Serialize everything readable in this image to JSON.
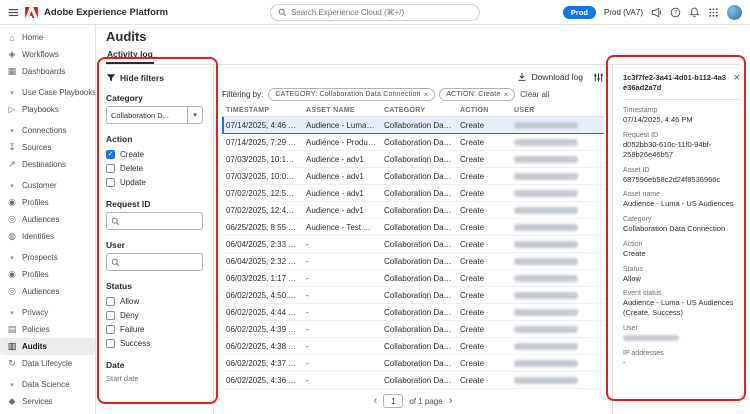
{
  "colors": {
    "accent_blue": "#1473E6",
    "adobe_red": "#EB1000",
    "annotation_red": "#E02020",
    "selected_row_bg": "#E4EFFB"
  },
  "header": {
    "app_title": "Adobe Experience Platform",
    "search_placeholder": "Search Experience Cloud (⌘+/)",
    "env_button": "Prod",
    "env_label": "Prod (VA7)"
  },
  "sidebar": {
    "items": [
      {
        "type": "item",
        "label": "Home",
        "icon": "home-icon",
        "glyph": "⌂"
      },
      {
        "type": "item",
        "label": "Workflows",
        "icon": "workflows-icon",
        "glyph": "◈"
      },
      {
        "type": "item",
        "label": "Dashboards",
        "icon": "dashboards-icon",
        "glyph": "▦"
      },
      {
        "type": "section",
        "label": "Use Case Playbooks"
      },
      {
        "type": "item",
        "label": "Playbooks",
        "icon": "playbooks-icon",
        "glyph": "▷"
      },
      {
        "type": "section",
        "label": "Connections"
      },
      {
        "type": "item",
        "label": "Sources",
        "icon": "sources-icon",
        "glyph": "↧"
      },
      {
        "type": "item",
        "label": "Destinations",
        "icon": "destinations-icon",
        "glyph": "↗"
      },
      {
        "type": "section",
        "label": "Customer"
      },
      {
        "type": "item",
        "label": "Profiles",
        "icon": "profiles-icon",
        "glyph": "◉"
      },
      {
        "type": "item",
        "label": "Audiences",
        "icon": "audiences-icon",
        "glyph": "◎"
      },
      {
        "type": "item",
        "label": "Identities",
        "icon": "identities-icon",
        "glyph": "◍"
      },
      {
        "type": "section",
        "label": "Prospects"
      },
      {
        "type": "item",
        "label": "Profiles",
        "icon": "profiles-icon",
        "glyph": "◉"
      },
      {
        "type": "item",
        "label": "Audiences",
        "icon": "audiences-icon",
        "glyph": "◎"
      },
      {
        "type": "section",
        "label": "Privacy"
      },
      {
        "type": "item",
        "label": "Policies",
        "icon": "policies-icon",
        "glyph": "▤"
      },
      {
        "type": "item",
        "label": "Audits",
        "icon": "audits-icon",
        "glyph": "▥",
        "active": true
      },
      {
        "type": "item",
        "label": "Data Lifecycle",
        "icon": "data-lifecycle-icon",
        "glyph": "↻"
      },
      {
        "type": "section",
        "label": "Data Science"
      },
      {
        "type": "item",
        "label": "Services",
        "icon": "services-icon",
        "glyph": "◆"
      }
    ]
  },
  "page": {
    "title": "Audits",
    "active_tab": "Activity log"
  },
  "filters": {
    "hide_label": "Hide filters",
    "category": {
      "label": "Category",
      "value": "Collaboration D..."
    },
    "action": {
      "label": "Action",
      "options": [
        {
          "label": "Create",
          "checked": true
        },
        {
          "label": "Delete",
          "checked": false
        },
        {
          "label": "Update",
          "checked": false
        }
      ]
    },
    "request_id": {
      "label": "Request ID"
    },
    "user": {
      "label": "User"
    },
    "status": {
      "label": "Status",
      "options": [
        {
          "label": "Allow",
          "checked": false
        },
        {
          "label": "Deny",
          "checked": false
        },
        {
          "label": "Failure",
          "checked": false
        },
        {
          "label": "Success",
          "checked": false
        }
      ]
    },
    "date": {
      "label": "Date",
      "start_label": "Start date"
    }
  },
  "toolbar": {
    "filtering_by": "Filtering by:",
    "chips": [
      "CATEGORY: Collaboration Data Connection",
      "ACTION: Create"
    ],
    "clear_all": "Clear all",
    "download_label": "Download log"
  },
  "table": {
    "columns": [
      "TIMESTAMP",
      "ASSET NAME",
      "CATEGORY",
      "ACTION",
      "USER"
    ],
    "rows": [
      {
        "timestamp": "07/14/2025, 4:46 PM",
        "asset_name": "Audience - Luma - US ...",
        "category": "Collaboration Data Co...",
        "action": "Create",
        "selected": true
      },
      {
        "timestamp": "07/14/2025, 7:29 AM",
        "asset_name": "Audience - Production",
        "category": "Collaboration Data Co...",
        "action": "Create"
      },
      {
        "timestamp": "07/03/2025, 10:10 AM",
        "asset_name": "Audience - adv1",
        "category": "Collaboration Data Co...",
        "action": "Create"
      },
      {
        "timestamp": "07/03/2025, 10:01 AM",
        "asset_name": "Audience - adv1",
        "category": "Collaboration Data Co...",
        "action": "Create"
      },
      {
        "timestamp": "07/02/2025, 12:57 PM",
        "asset_name": "Audience - adv1",
        "category": "Collaboration Data Co...",
        "action": "Create"
      },
      {
        "timestamp": "07/02/2025, 12:49 PM",
        "asset_name": "Audience - adv1",
        "category": "Collaboration Data Co...",
        "action": "Create"
      },
      {
        "timestamp": "06/25/2025, 8:55 AM",
        "asset_name": "Audience - Test AAM A...",
        "category": "Collaboration Data Co...",
        "action": "Create"
      },
      {
        "timestamp": "06/04/2025, 2:33 PM",
        "asset_name": "-",
        "category": "Collaboration Data Co...",
        "action": "Create"
      },
      {
        "timestamp": "06/04/2025, 2:32 PM",
        "asset_name": "-",
        "category": "Collaboration Data Co...",
        "action": "Create"
      },
      {
        "timestamp": "06/03/2025, 1:17 PM",
        "asset_name": "-",
        "category": "Collaboration Data Co...",
        "action": "Create"
      },
      {
        "timestamp": "06/02/2025, 4:50 PM",
        "asset_name": "-",
        "category": "Collaboration Data Co...",
        "action": "Create"
      },
      {
        "timestamp": "06/02/2025, 4:44 PM",
        "asset_name": "-",
        "category": "Collaboration Data Co...",
        "action": "Create"
      },
      {
        "timestamp": "06/02/2025, 4:39 PM",
        "asset_name": "-",
        "category": "Collaboration Data Co...",
        "action": "Create"
      },
      {
        "timestamp": "06/02/2025, 4:38 PM",
        "asset_name": "-",
        "category": "Collaboration Data Co...",
        "action": "Create"
      },
      {
        "timestamp": "06/02/2025, 4:37 PM",
        "asset_name": "-",
        "category": "Collaboration Data Co...",
        "action": "Create"
      },
      {
        "timestamp": "06/02/2025, 4:36 PM",
        "asset_name": "-",
        "category": "Collaboration Data Co...",
        "action": "Create"
      }
    ]
  },
  "pagination": {
    "page": "1",
    "suffix": "of 1 page"
  },
  "detail": {
    "id": "1c3f7fe2-3a41-4d01-b112-4a3e36ad2a7d",
    "fields": [
      {
        "label": "Timestamp",
        "value": "07/14/2025, 4:46 PM"
      },
      {
        "label": "Request ID",
        "value": "d052bb30-610c-11f0-94bf-258b26e46b57"
      },
      {
        "label": "Asset ID",
        "value": "687596eb58c2d24f8536966c"
      },
      {
        "label": "Asset name",
        "value": "Audience - Luma - US Audiences"
      },
      {
        "label": "Category",
        "value": "Collaboration Data Connection"
      },
      {
        "label": "Action",
        "value": "Create"
      },
      {
        "label": "Status",
        "value": "Allow"
      },
      {
        "label": "Event status",
        "value": "Audience - Luma - US Audiences (Create, Success)"
      },
      {
        "label": "User",
        "value": "",
        "redacted": true
      },
      {
        "label": "IP addresses",
        "value": "-"
      }
    ]
  }
}
